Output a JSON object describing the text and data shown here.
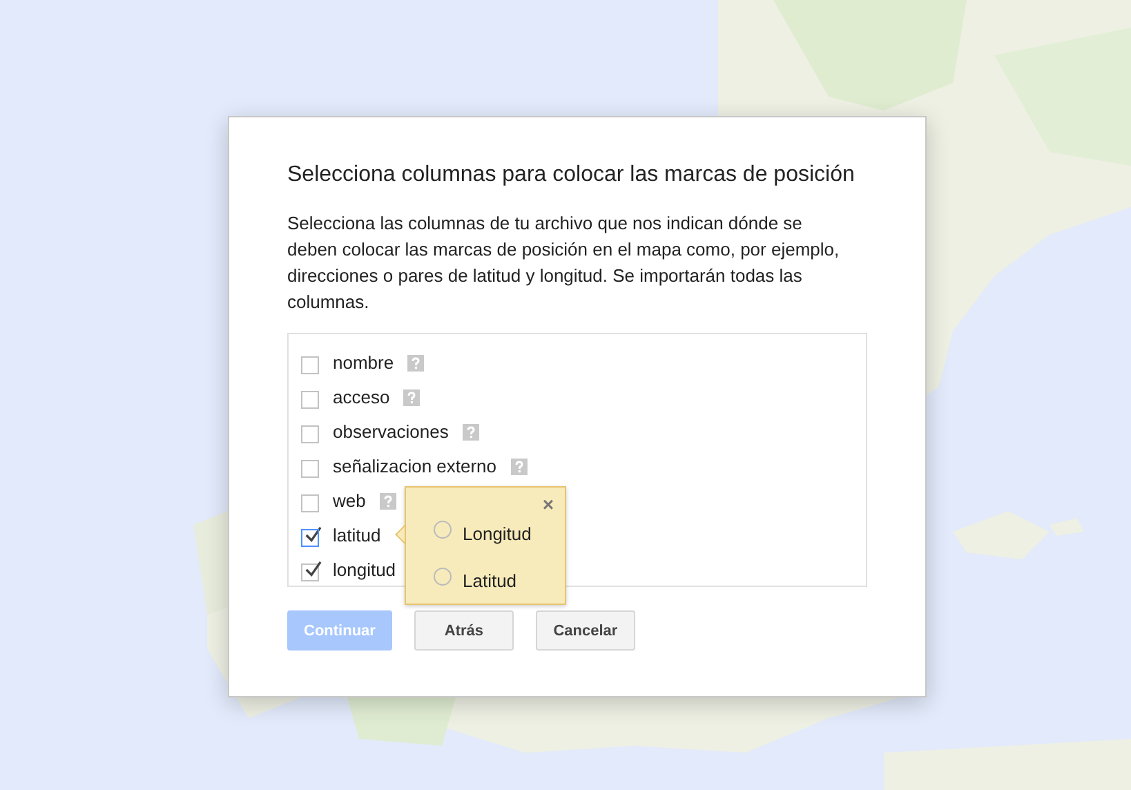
{
  "dialog": {
    "title": "Selecciona columnas para colocar las marcas de posición",
    "description": "Selecciona las columnas de tu archivo que nos indican dónde se deben colocar las marcas de posición en el mapa como, por ejemplo, direcciones o pares de latitud y longitud. Se importarán todas las columnas.",
    "columns": [
      {
        "label": "nombre",
        "checked": false,
        "focused": false,
        "help": true
      },
      {
        "label": "acceso",
        "checked": false,
        "focused": false,
        "help": true
      },
      {
        "label": "observaciones",
        "checked": false,
        "focused": false,
        "help": true
      },
      {
        "label": "señalizacion externo",
        "checked": false,
        "focused": false,
        "help": true
      },
      {
        "label": "web",
        "checked": false,
        "focused": false,
        "help": true
      },
      {
        "label": "latitud",
        "checked": true,
        "focused": true,
        "help": false
      },
      {
        "label": "longitud",
        "checked": true,
        "focused": false,
        "help": false
      }
    ],
    "popup": {
      "close": "×",
      "options": [
        {
          "label": "Longitud",
          "selected": false
        },
        {
          "label": "Latitud",
          "selected": false
        }
      ]
    },
    "buttons": [
      {
        "label": "Continuar",
        "disabled": true,
        "primary": true
      },
      {
        "label": "Atrás",
        "disabled": false,
        "primary": false
      },
      {
        "label": "Cancelar",
        "disabled": false,
        "primary": false
      }
    ]
  }
}
